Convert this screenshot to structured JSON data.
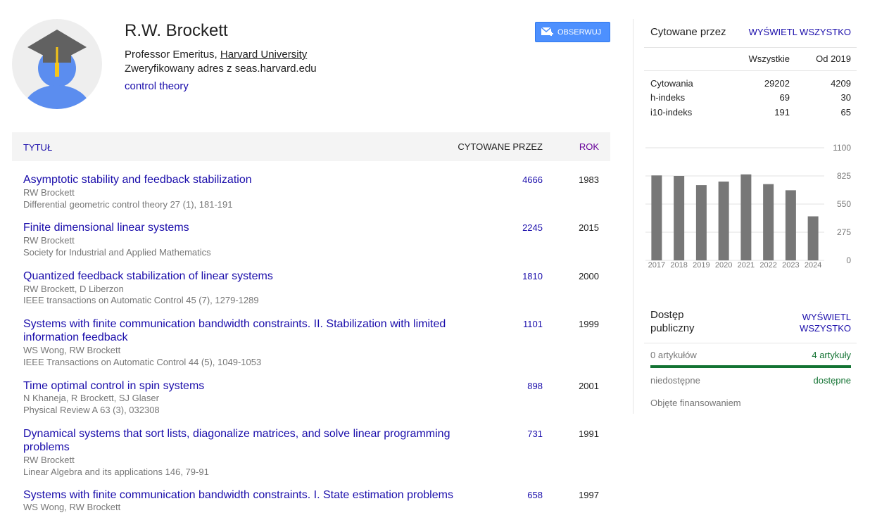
{
  "profile": {
    "name": "R.W. Brockett",
    "affiliation_prefix": "Professor Emeritus, ",
    "affiliation_link": "Harvard University",
    "email": "Zweryfikowany adres z seas.harvard.edu",
    "interest": "control theory",
    "follow_label": "OBSERWUJ"
  },
  "table": {
    "col_title": "TYTUŁ",
    "col_cited": "CYTOWANE PRZEZ",
    "col_year": "ROK",
    "rows": [
      {
        "title": "Asymptotic stability and feedback stabilization",
        "authors": "RW Brockett",
        "pub": "Differential geometric control theory 27 (1), 181-191",
        "cited": "4666",
        "year": "1983"
      },
      {
        "title": "Finite dimensional linear systems",
        "authors": "RW Brockett",
        "pub": "Society for Industrial and Applied Mathematics",
        "cited": "2245",
        "year": "2015"
      },
      {
        "title": "Quantized feedback stabilization of linear systems",
        "authors": "RW Brockett, D Liberzon",
        "pub": "IEEE transactions on Automatic Control 45 (7), 1279-1289",
        "cited": "1810",
        "year": "2000"
      },
      {
        "title": "Systems with finite communication bandwidth constraints. II. Stabilization with limited information feedback",
        "authors": "WS Wong, RW Brockett",
        "pub": "IEEE Transactions on Automatic Control 44 (5), 1049-1053",
        "cited": "1101",
        "year": "1999"
      },
      {
        "title": "Time optimal control in spin systems",
        "authors": "N Khaneja, R Brockett, SJ Glaser",
        "pub": "Physical Review A 63 (3), 032308",
        "cited": "898",
        "year": "2001"
      },
      {
        "title": "Dynamical systems that sort lists, diagonalize matrices, and solve linear programming problems",
        "authors": "RW Brockett",
        "pub": "Linear Algebra and its applications 146, 79-91",
        "cited": "731",
        "year": "1991"
      },
      {
        "title": "Systems with finite communication bandwidth constraints. I. State estimation problems",
        "authors": "WS Wong, RW Brockett",
        "pub": "",
        "cited": "658",
        "year": "1997"
      }
    ]
  },
  "sidebar": {
    "cited_by": "Cytowane przez",
    "view_all": "WYŚWIETL WSZYSTKO",
    "col_all": "Wszystkie",
    "col_since": "Od 2019",
    "stats": [
      {
        "label": "Cytowania",
        "all": "29202",
        "since": "4209"
      },
      {
        "label": "h-indeks",
        "all": "69",
        "since": "30"
      },
      {
        "label": "i10-indeks",
        "all": "191",
        "since": "65"
      }
    ],
    "open_access": {
      "title_line1": "Dostęp",
      "title_line2": "publiczny",
      "link_line1": "WYŚWIETL",
      "link_line2": "WSZYSTKO",
      "left_count": "0 artykułów",
      "right_count": "4 artykuły",
      "left_label": "niedostępne",
      "right_label": "dostępne",
      "funding": "Objęte finansowaniem",
      "available_fraction": 1.0
    }
  },
  "chart_data": {
    "type": "bar",
    "categories": [
      "2017",
      "2018",
      "2019",
      "2020",
      "2021",
      "2022",
      "2023",
      "2024"
    ],
    "values": [
      830,
      825,
      735,
      770,
      840,
      745,
      685,
      430
    ],
    "yticks": [
      0,
      275,
      550,
      825,
      1100
    ],
    "ylim": [
      0,
      1100
    ],
    "grid": true,
    "bar_color": "#777777"
  }
}
